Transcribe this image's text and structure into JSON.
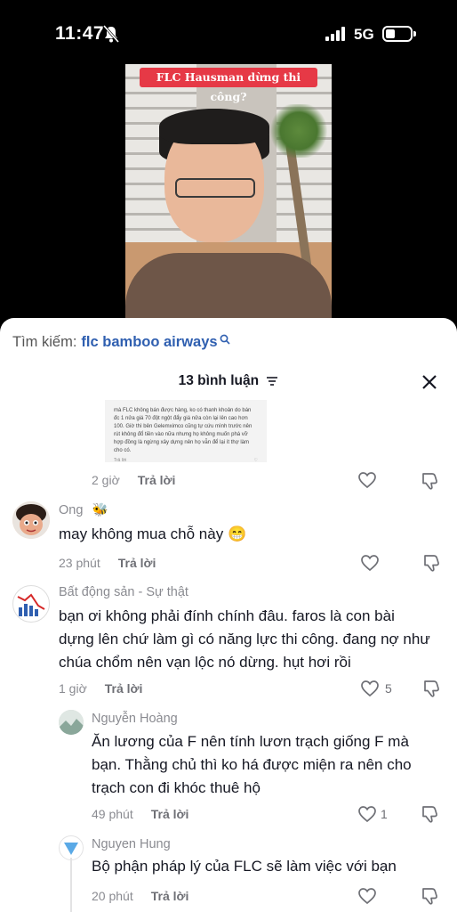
{
  "status": {
    "time": "11:47",
    "network": "5G"
  },
  "video": {
    "title_overlay": "FLC Hausman dừng thi công?"
  },
  "search": {
    "label": "Tìm kiếm:",
    "term": "flc bamboo airways"
  },
  "comments_header": {
    "count_label": "13 bình luận"
  },
  "screenshot_comment": {
    "text": "mà FLC không bán được hàng, ko có thanh khoản do bán đc 1 nửa giá 70 đột ngột đẩy giá nửa còn lại lên cao hơn 100. Giờ thì bên Gelemximco cũng tự cứu mình trước nên rút không đổ tiền vào nữa nhưng họ không muốn phá vỡ hợp đồng là ngừng xây dựng nên họ vẫn để lại ít thợ làm cho có.",
    "reply_label": "Trả lời"
  },
  "comments": [
    {
      "id": "c0",
      "time": "2 giờ",
      "reply_label": "Trả lời"
    },
    {
      "id": "c1",
      "name": "Ong",
      "name_emoji": "🐝",
      "text": "may không mua chỗ này 😁",
      "time": "23 phút",
      "reply_label": "Trả lời"
    },
    {
      "id": "c2",
      "name": "Bất động sản - Sự thật",
      "text": "bạn ơi không phải đính chính đâu. faros là con bài dựng lên chứ làm gì có năng lực thi công. đang nợ như chúa chổm nên vạn lộc nó dừng. hụt hơi rồi",
      "time": "1 giờ",
      "reply_label": "Trả lời",
      "likes": "5"
    },
    {
      "id": "r1",
      "name": "Nguyễn Hoàng",
      "text": "Ăn lương của F nên tính lươn trạch giống F mà bạn. Thằng chủ thì ko há được miện ra nên cho trạch con đi khóc thuê hộ",
      "time": "49 phút",
      "reply_label": "Trả lời",
      "likes": "1"
    },
    {
      "id": "r2",
      "name": "Nguyen Hung",
      "text": "Bộ phận pháp lý của FLC sẽ làm việc với bạn",
      "time": "20 phút",
      "reply_label": "Trả lời"
    }
  ],
  "colors": {
    "accent": "#2f5fb0",
    "title_red": "#e63946",
    "muted": "#8a8b91"
  }
}
